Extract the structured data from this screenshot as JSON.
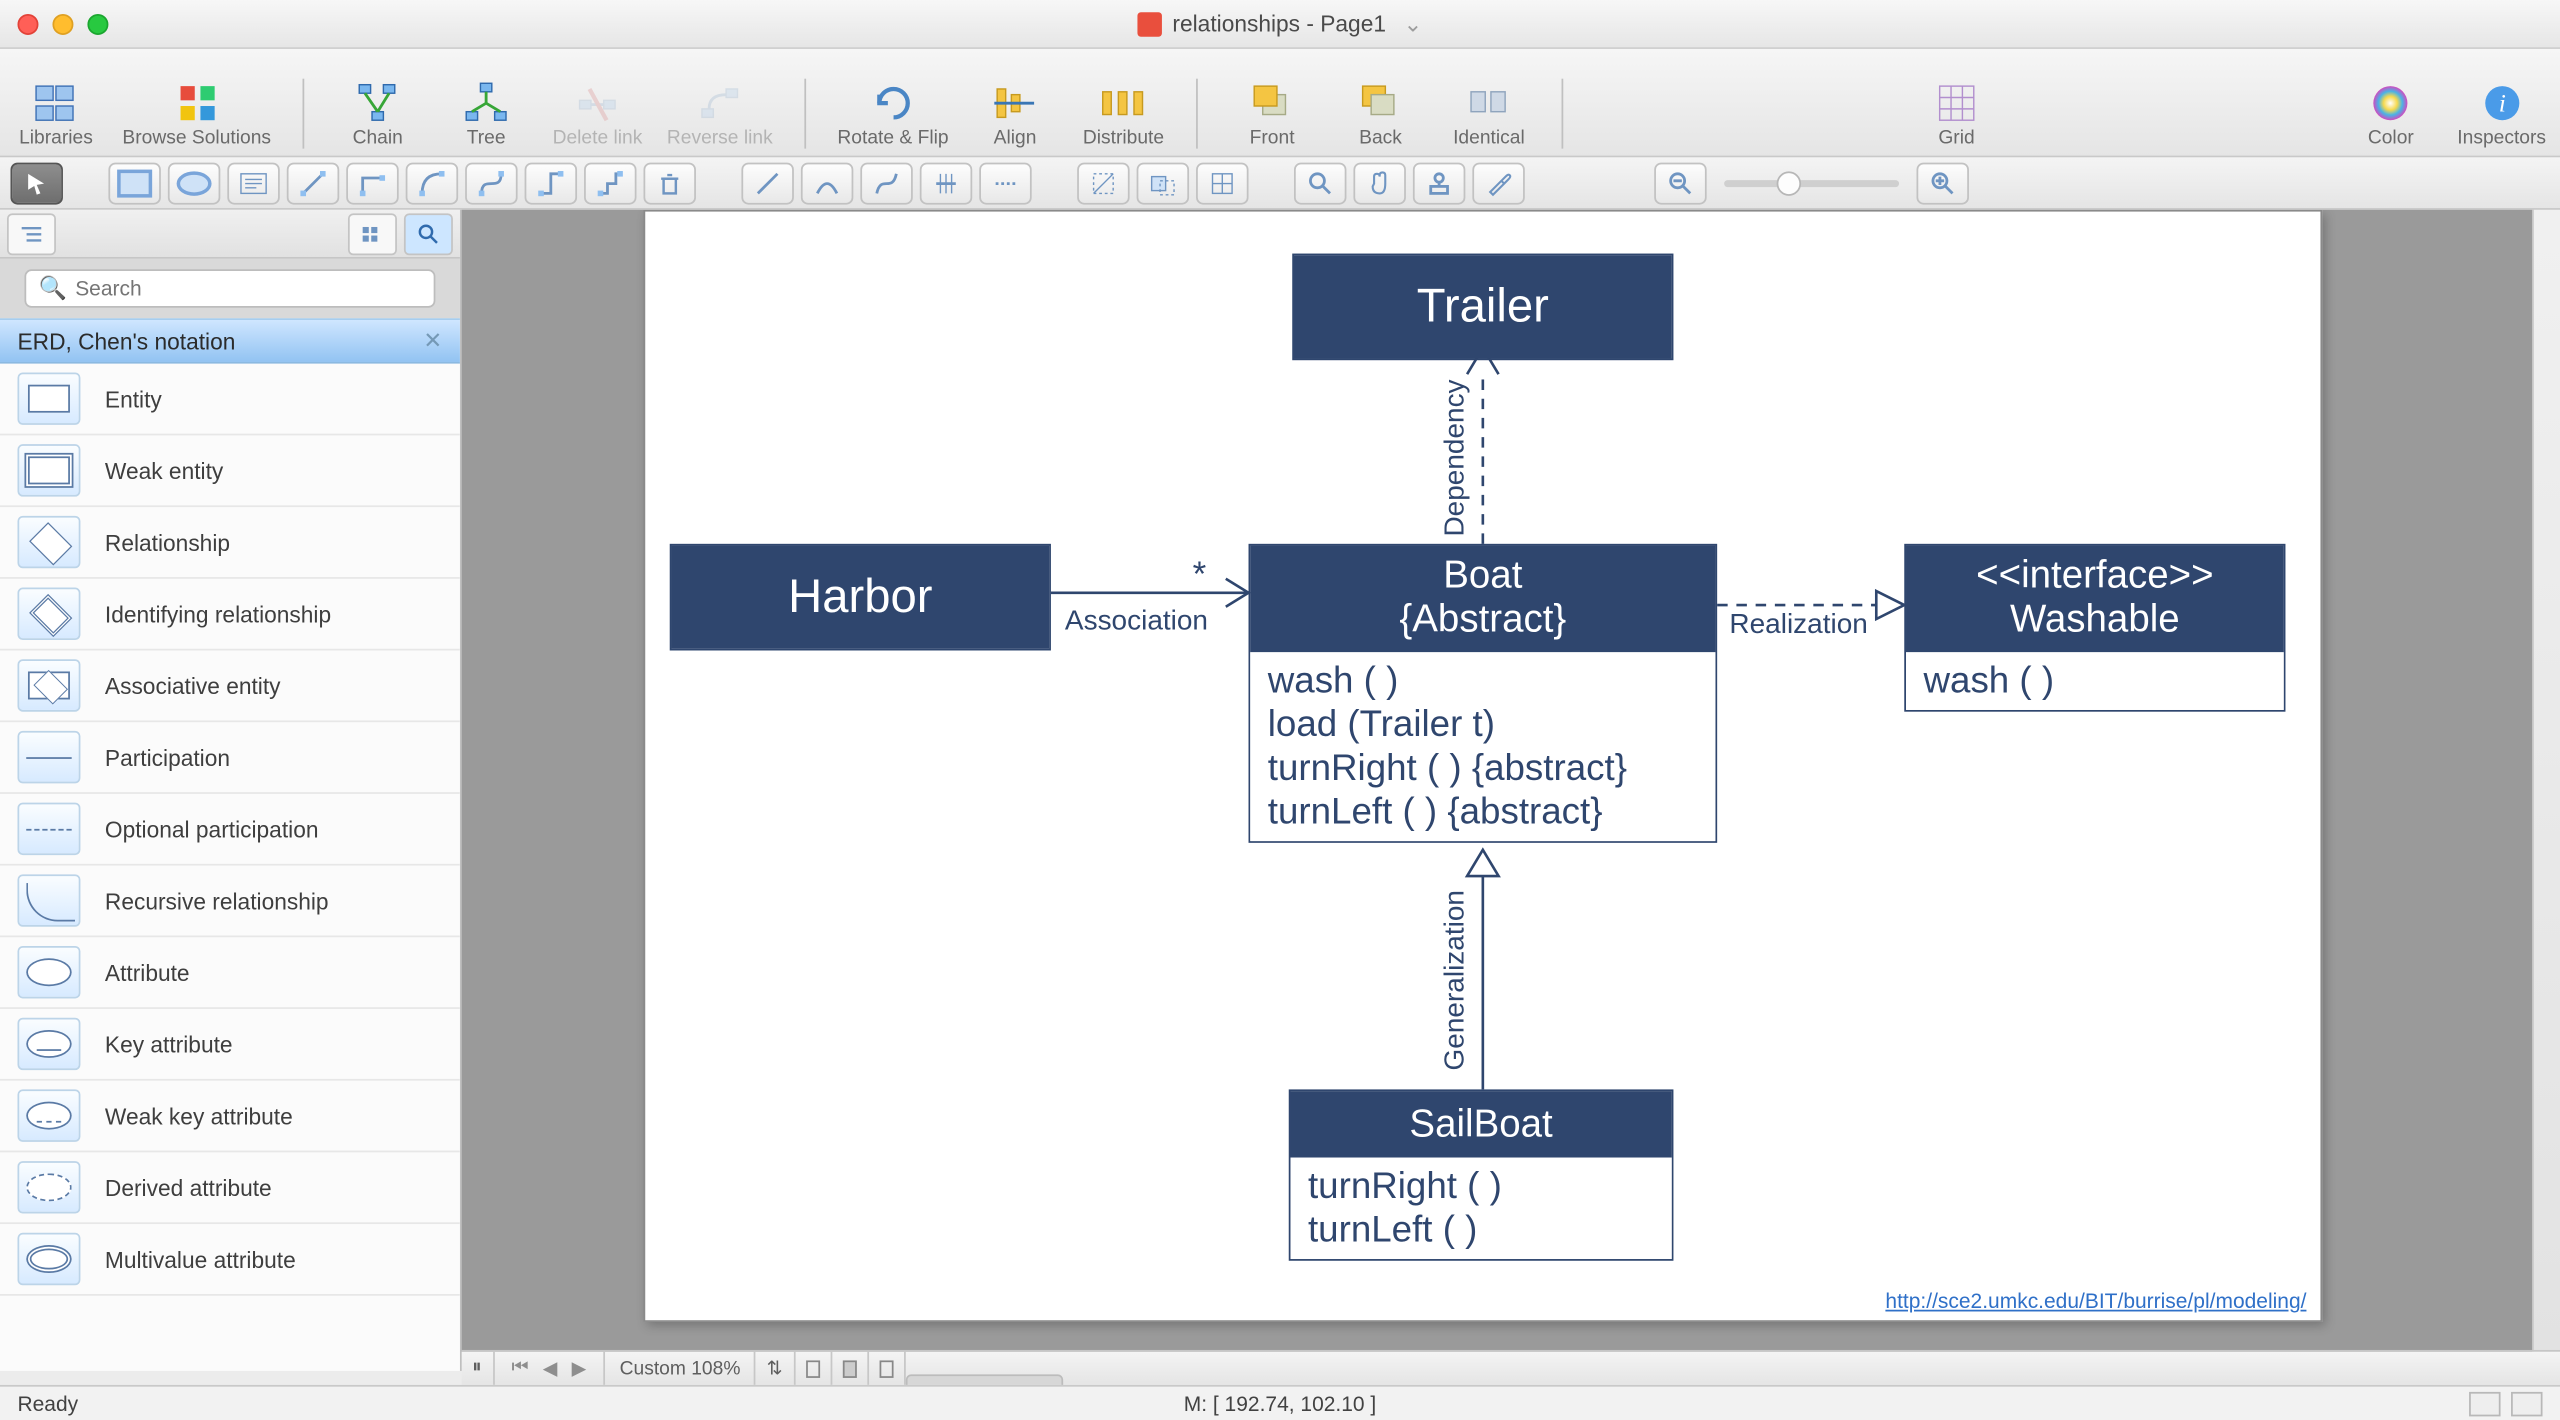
{
  "window": {
    "title": "relationships - Page1"
  },
  "toolbar": {
    "libraries": "Libraries",
    "browse": "Browse Solutions",
    "chain": "Chain",
    "tree": "Tree",
    "delete_link": "Delete link",
    "reverse_link": "Reverse link",
    "rotate_flip": "Rotate & Flip",
    "align": "Align",
    "distribute": "Distribute",
    "front": "Front",
    "back": "Back",
    "identical": "Identical",
    "grid": "Grid",
    "color": "Color",
    "inspectors": "Inspectors"
  },
  "sidebar": {
    "search_placeholder": "Search",
    "panel_title": "ERD, Chen's notation",
    "items": [
      "Entity",
      "Weak entity",
      "Relationship",
      "Identifying relationship",
      "Associative entity",
      "Participation",
      "Optional participation",
      "Recursive relationship",
      "Attribute",
      "Key attribute",
      "Weak key attribute",
      "Derived attribute",
      "Multivalue attribute"
    ]
  },
  "diagram": {
    "trailer": "Trailer",
    "harbor": "Harbor",
    "boat_head1": "Boat",
    "boat_head2": "{Abstract}",
    "boat_ops": [
      "wash ( )",
      "load (Trailer t)",
      "turnRight ( ) {abstract}",
      "turnLeft ( ) {abstract}"
    ],
    "washable_head1": "<<interface>>",
    "washable_head2": "Washable",
    "washable_ops": [
      "wash ( )"
    ],
    "sailboat_head": "SailBoat",
    "sailboat_ops": [
      "turnRight ( )",
      "turnLeft ( )"
    ],
    "l_association": "Association",
    "l_star": "*",
    "l_dependency": "Dependency",
    "l_generalization": "Generalization",
    "l_realization": "Realization",
    "url": "http://sce2.umkc.edu/BIT/burrise/pl/modeling/"
  },
  "pagebar": {
    "custom": "Custom 108%"
  },
  "status": {
    "ready": "Ready",
    "mouse": "M: [ 192.74, 102.10 ]"
  }
}
